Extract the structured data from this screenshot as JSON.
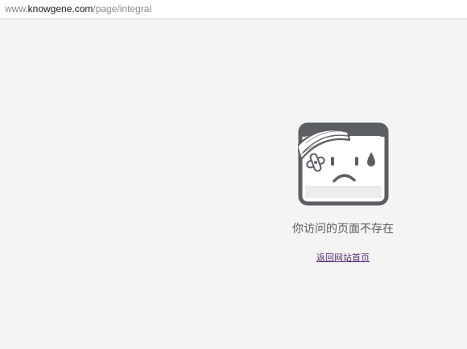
{
  "address_bar": {
    "url_prefix": "www.",
    "url_domain": "knowgene.com",
    "url_path": "/page/integral"
  },
  "error": {
    "illustration": "sad-bandaged-face-icon",
    "message": "你访问的页面不存在",
    "home_link_label": "返回网站首页"
  },
  "colors": {
    "background": "#f4f4f4",
    "face_border": "#5b5e63",
    "link": "#5a2d7a",
    "tear": "#5b5e63"
  }
}
